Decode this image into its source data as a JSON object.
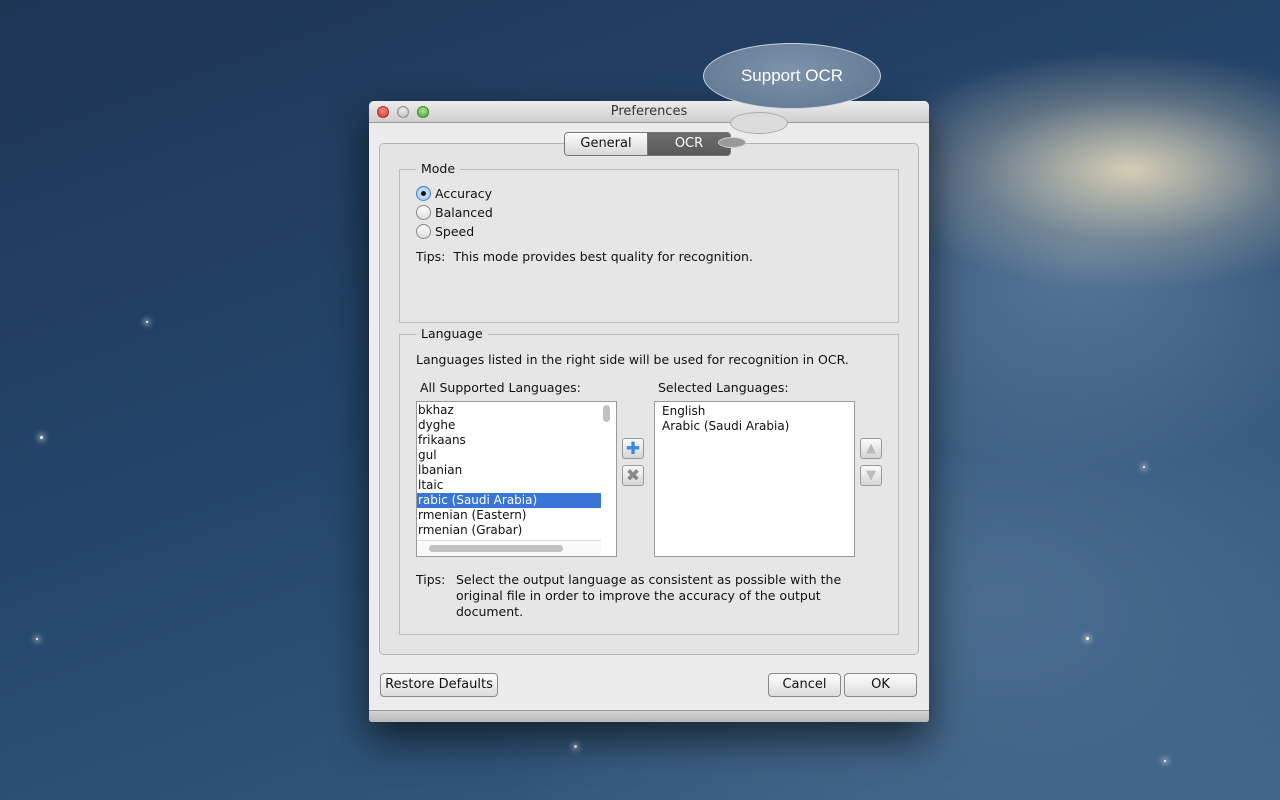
{
  "callout": "Support OCR",
  "window": {
    "title": "Preferences"
  },
  "tabs": [
    {
      "label": "General"
    },
    {
      "label": "OCR"
    }
  ],
  "mode": {
    "legend": "Mode",
    "options": [
      "Accuracy",
      "Balanced",
      "Speed"
    ],
    "selected": "Accuracy",
    "tips_label": "Tips:",
    "tips": "This mode provides best quality for recognition."
  },
  "language": {
    "legend": "Language",
    "description": "Languages listed in the right side will be used for recognition in OCR.",
    "all_label": "All Supported Languages:",
    "selected_label": "Selected Languages:",
    "all": [
      "bkhaz",
      "dyghe",
      "frikaans",
      "gul",
      "lbanian",
      "ltaic",
      "rabic (Saudi Arabia)",
      "rmenian (Eastern)",
      "rmenian (Grabar)"
    ],
    "all_selected_index": 6,
    "selected": [
      "English",
      "Arabic (Saudi Arabia)"
    ],
    "tips_label": "Tips:",
    "tips": "Select the output language as consistent as possible with the original file in order to improve the accuracy of the output document."
  },
  "footer": {
    "restore": "Restore Defaults",
    "cancel": "Cancel",
    "ok": "OK"
  }
}
